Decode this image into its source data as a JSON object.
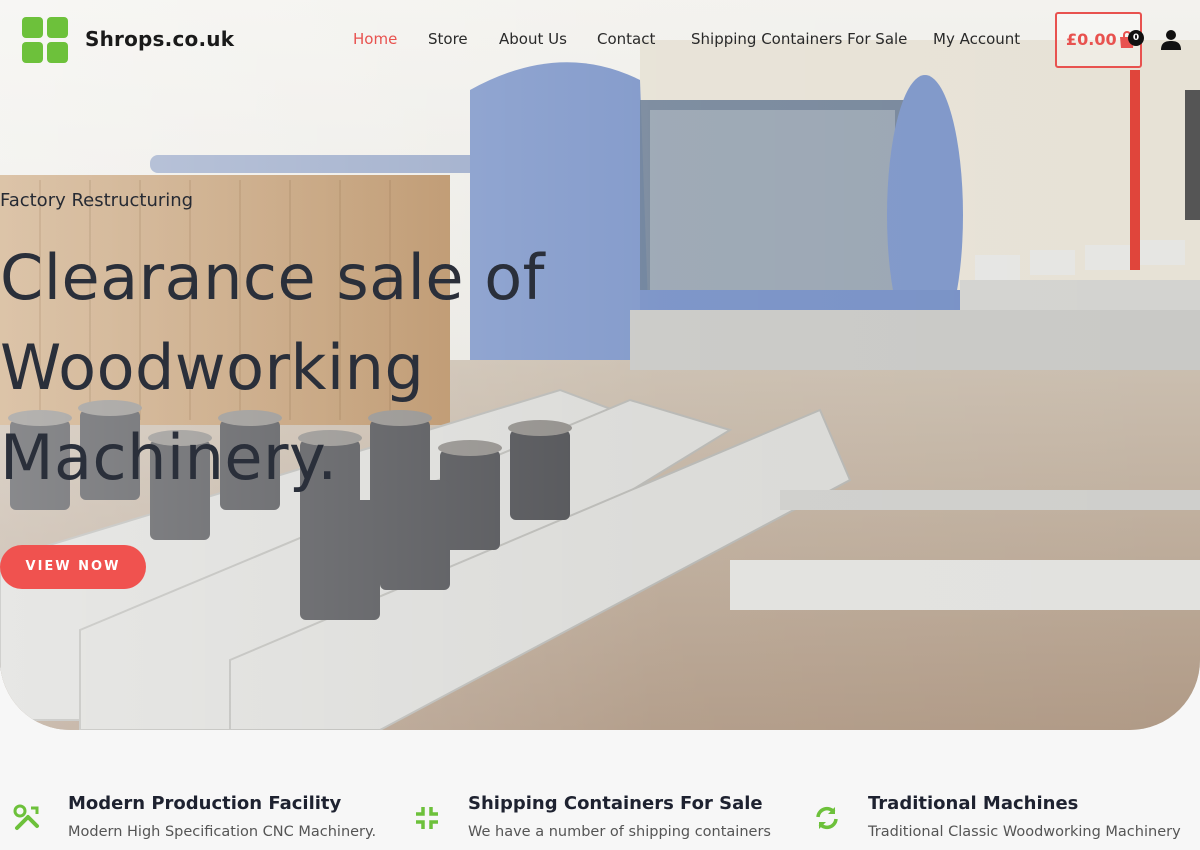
{
  "brand": {
    "name": "Shrops.co.uk",
    "logo_color": "#6dc13b"
  },
  "nav": {
    "items": [
      {
        "label": "Home",
        "active": true
      },
      {
        "label": "Store"
      },
      {
        "label": "About Us"
      },
      {
        "label": "Contact"
      },
      {
        "label": "Shipping Containers For Sale"
      },
      {
        "label": "My Account"
      }
    ],
    "active_color": "#e8524f"
  },
  "cart": {
    "total": "£0.00",
    "count": "0",
    "icon": "shopping-bag-icon"
  },
  "account": {
    "icon": "user-icon"
  },
  "hero": {
    "subtitle": "Factory Restructuring",
    "title": "Clearance sale of Woodworking Machinery.",
    "button_label": "VIEW NOW",
    "button_color": "#f0524f"
  },
  "features": [
    {
      "icon": "tools-icon",
      "title": "Modern Production Facility",
      "text": "Modern High Specification CNC Machinery."
    },
    {
      "icon": "compress-icon",
      "title": "Shipping Containers For Sale",
      "text": "We have a number of shipping containers"
    },
    {
      "icon": "refresh-icon",
      "title": "Traditional Machines",
      "text": "Traditional Classic Woodworking Machinery"
    }
  ],
  "accent_color": "#6dc13b"
}
